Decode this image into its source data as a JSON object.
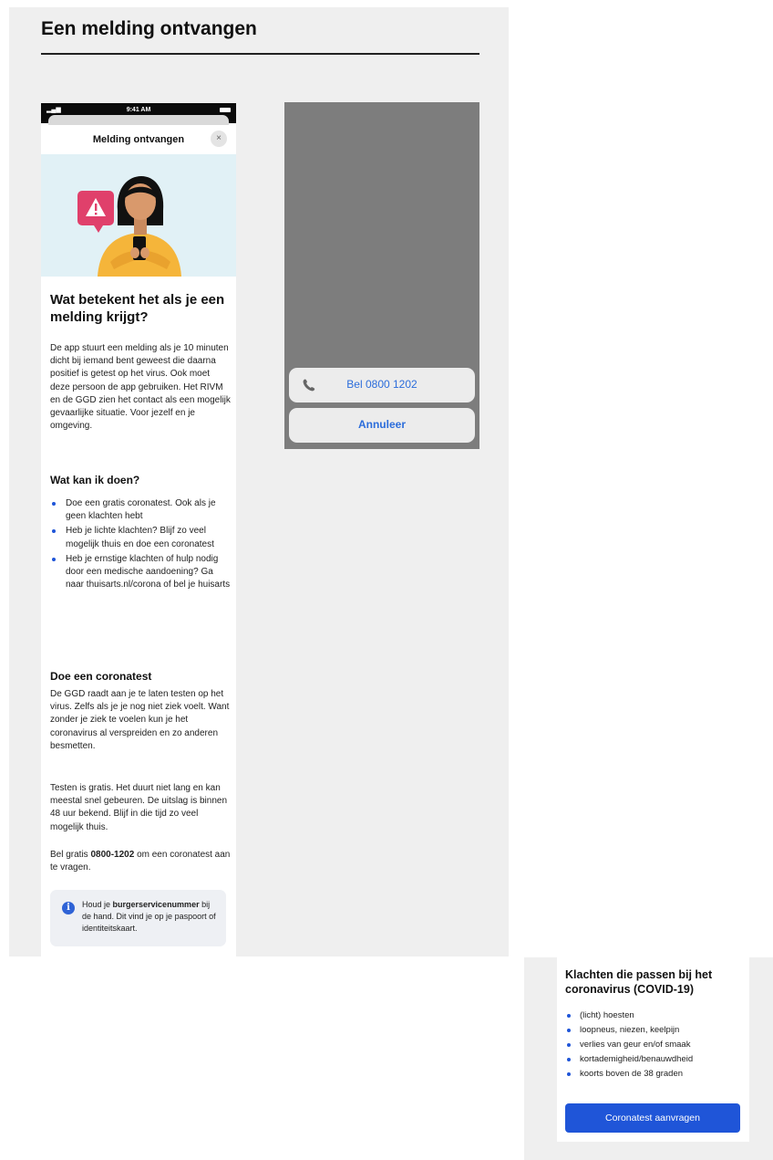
{
  "page": {
    "title": "Een melding ontvangen"
  },
  "phone": {
    "status_time": "9:41 AM",
    "nav_title": "Melding ontvangen",
    "close_label": "×",
    "heading": "Wat betekent het als je een melding krijgt?",
    "intro": "De app stuurt een melding als je 10 minuten dicht bij iemand bent geweest die daarna positief is getest op het virus. Ook moet deze persoon de app gebruiken. Het RIVM en de GGD zien het contact als een mogelijk gevaarlijke situatie. Voor jezelf en je omgeving.",
    "section_todo": {
      "title": "Wat kan ik doen?",
      "items": [
        "Doe een gratis coronatest. Ook als je geen klachten hebt",
        "Heb je lichte klachten? Blijf zo veel mogelijk thuis en doe een coronatest",
        "Heb je ernstige klachten of hulp nodig door een medische aandoening? Ga naar thuisarts.nl/corona of bel je huisarts"
      ]
    },
    "section_test": {
      "title": "Doe een coronatest",
      "p1": "De GGD raadt aan je te laten testen op het virus. Zelfs als je je nog niet ziek voelt. Want zonder je ziek te voelen kun je het coronavirus al verspreiden en zo anderen besmetten.",
      "p2": "Testen is gratis. Het duurt niet lang en kan meestal snel gebeuren. De uitslag is binnen 48 uur bekend. Blijf in die tijd zo veel mogelijk thuis.",
      "p3_prefix": "Bel gratis ",
      "p3_number": "0800-1202",
      "p3_suffix": " om een coronatest aan te vragen."
    },
    "info": {
      "icon": "i",
      "prefix": "Houd je ",
      "bold": "burgerservicenummer",
      "suffix": " bij de hand. Dit vind je op je paspoort of identiteitskaart."
    }
  },
  "action_sheet": {
    "call_label": "Bel 0800 1202",
    "cancel_label": "Annuleer"
  },
  "symptoms_card": {
    "title": "Klachten die passen bij het coronavirus (COVID-19)",
    "items": [
      "(licht) hoesten",
      "loopneus, niezen, keelpijn",
      "verlies van geur en/of smaak",
      "kortademigheid/benauwdheid",
      "koorts boven de 38 graden"
    ],
    "button_label": "Coronatest aanvragen"
  },
  "colors": {
    "accent_blue": "#1f55d8",
    "link_blue": "#2c6ddb",
    "hero_background": "#e1f1f6",
    "alert_red": "#e0406b",
    "sweater_yellow": "#f5b53a"
  },
  "icons": {
    "warning": "warning-icon",
    "close": "close-icon",
    "phone": "phone-icon",
    "info": "info-icon"
  }
}
